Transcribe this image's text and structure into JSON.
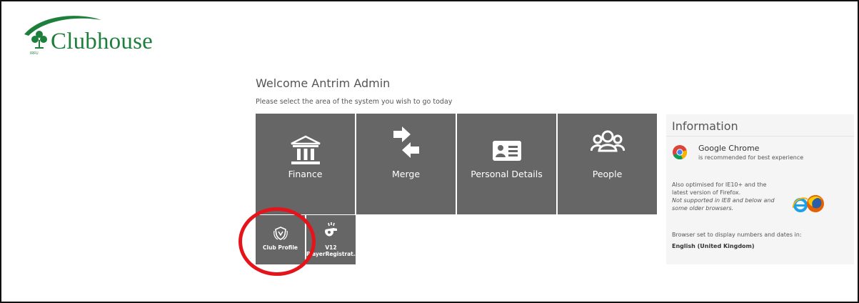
{
  "logo": {
    "text": "Clubhouse",
    "subtext": "IRFU",
    "color": "#1e7f3c"
  },
  "welcome": "Welcome Antrim Admin",
  "subtitle": "Please select the area of the system you wish to go today",
  "tiles": [
    {
      "label": "Finance",
      "icon": "bank-icon"
    },
    {
      "label": "Merge",
      "icon": "merge-arrows-icon"
    },
    {
      "label": "Personal Details",
      "icon": "id-card-icon"
    },
    {
      "label": "People",
      "icon": "people-group-icon"
    }
  ],
  "small_tiles": [
    {
      "label": "Club Profile",
      "icon": "club-crest-icon"
    },
    {
      "label_line1": "V12",
      "label_line2": "PlayerRegistrat…",
      "icon": "whistle-icon"
    }
  ],
  "info": {
    "title": "Information",
    "chrome_title": "Google Chrome",
    "chrome_sub": "is recommended for best experience",
    "optimised_line1": "Also optimised for IE10+ and the",
    "optimised_line2": "latest version of Firefox.",
    "not_supported_line1": "Not supported in IE8 and below and",
    "not_supported_line2": "some older browsers.",
    "browser_set": "Browser set to display numbers and dates in:",
    "locale": "English (United Kingdom)"
  },
  "colors": {
    "tile": "#666666",
    "highlight": "#e5141b",
    "panel": "#f5f5f5"
  }
}
